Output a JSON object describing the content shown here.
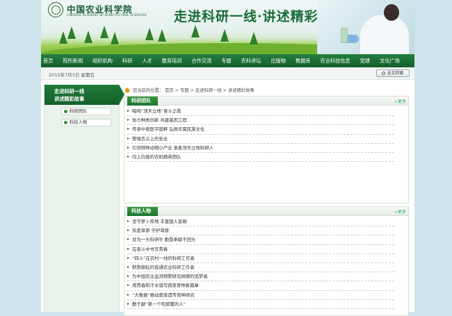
{
  "banner": {
    "logo_cn": "中国农业科学院",
    "logo_en": "CHINESE ACADEMY OF AGRICULTURAL SCIENCES",
    "slogan": "走进科研一线·讲述精彩故事"
  },
  "nav": {
    "items": [
      "首页",
      "院所新闻",
      "组织机构",
      "科研",
      "人才",
      "教育培训",
      "合作交流",
      "专题",
      "农科讲坛",
      "出版物",
      "数据库",
      "农业科技信息",
      "党建",
      "文化广场"
    ]
  },
  "datebar": {
    "date": "2015年7月3日 星期五",
    "search_label": "全文检索"
  },
  "sidebar": {
    "title_line1": "走进科研一线",
    "title_line2": "讲述精彩故事",
    "items": [
      "科研团队",
      "科技人物"
    ]
  },
  "breadcrumb": {
    "prefix": "您当前的位置：",
    "path": "首页 > 专题 > 走进科研一线 > 讲述精彩故事"
  },
  "section_team": {
    "title": "科研团队",
    "more": "更多",
    "items": [
      "唱响“顶天立地”奋斗之歌",
      "协力种质创新 共建基因工程",
      "传承中兽医学国粹 弘扬华夏民族文化",
      "警惕舌尖上的安全",
      "引领特种动物小产业 奋勇顶天立地科研人",
      "向上向善的农机精英团队"
    ]
  },
  "section_people": {
    "title": "科技人物",
    "more": "更多",
    "items": [
      "坚守萝卜阵地 丰富国人饭碗",
      "热爱草原 守护草原",
      "甘为一头科研牛 勤恳奉献不回头",
      "在奋斗中书写青春",
      "“四斗”在农村一线的科研工作者",
      "默默耕耘的普通农业科研工作者",
      "为中国农业监测预警研究拼搏的追梦者",
      "用青春和汗水谱写蔬菜育种新篇章",
      "“大数据”推动蔬菜遗传育种研究",
      "勤于献“第一个吃螃蟹的人”"
    ]
  }
}
